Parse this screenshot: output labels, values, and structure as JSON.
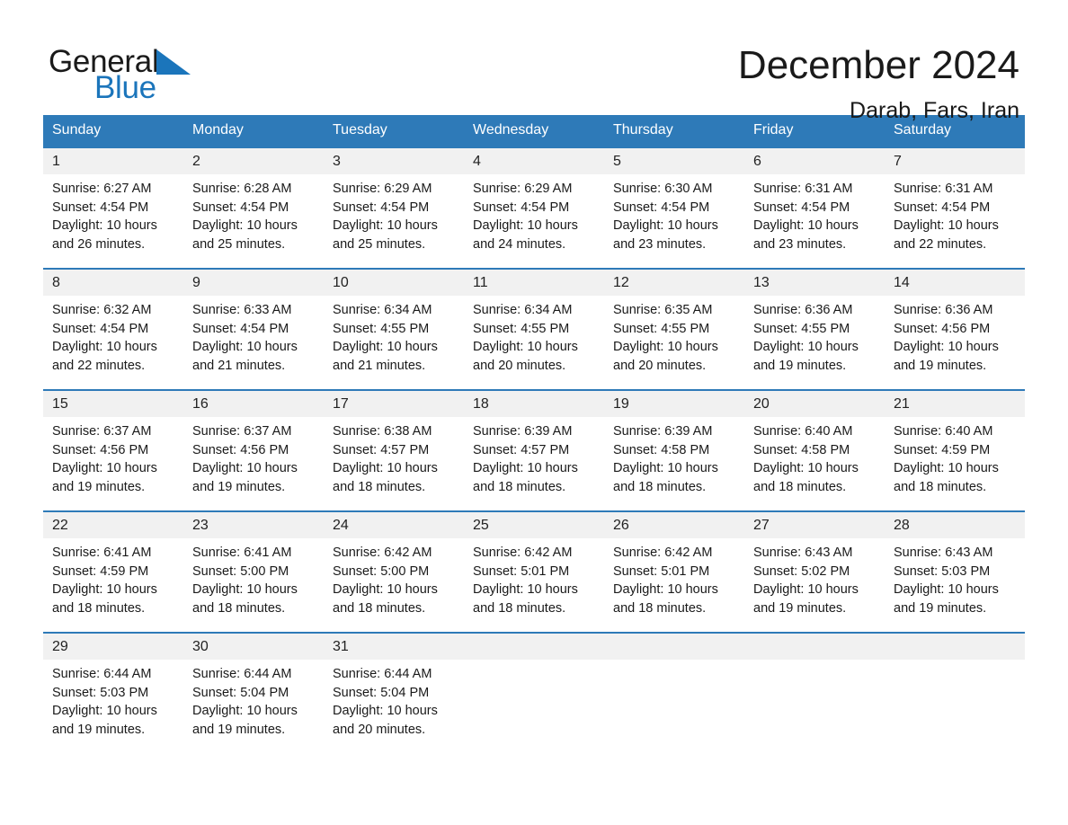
{
  "brand": {
    "name_part1": "General",
    "name_part2": "Blue",
    "accent_color": "#1b75bb"
  },
  "header": {
    "month_title": "December 2024",
    "location": "Darab, Fars, Iran"
  },
  "calendar": {
    "header_color": "#2e7ab8",
    "weekdays": [
      "Sunday",
      "Monday",
      "Tuesday",
      "Wednesday",
      "Thursday",
      "Friday",
      "Saturday"
    ],
    "labels": {
      "sunrise": "Sunrise:",
      "sunset": "Sunset:",
      "daylight": "Daylight:"
    },
    "weeks": [
      [
        {
          "day": "1",
          "sunrise": "Sunrise: 6:27 AM",
          "sunset": "Sunset: 4:54 PM",
          "daylight": "Daylight: 10 hours and 26 minutes."
        },
        {
          "day": "2",
          "sunrise": "Sunrise: 6:28 AM",
          "sunset": "Sunset: 4:54 PM",
          "daylight": "Daylight: 10 hours and 25 minutes."
        },
        {
          "day": "3",
          "sunrise": "Sunrise: 6:29 AM",
          "sunset": "Sunset: 4:54 PM",
          "daylight": "Daylight: 10 hours and 25 minutes."
        },
        {
          "day": "4",
          "sunrise": "Sunrise: 6:29 AM",
          "sunset": "Sunset: 4:54 PM",
          "daylight": "Daylight: 10 hours and 24 minutes."
        },
        {
          "day": "5",
          "sunrise": "Sunrise: 6:30 AM",
          "sunset": "Sunset: 4:54 PM",
          "daylight": "Daylight: 10 hours and 23 minutes."
        },
        {
          "day": "6",
          "sunrise": "Sunrise: 6:31 AM",
          "sunset": "Sunset: 4:54 PM",
          "daylight": "Daylight: 10 hours and 23 minutes."
        },
        {
          "day": "7",
          "sunrise": "Sunrise: 6:31 AM",
          "sunset": "Sunset: 4:54 PM",
          "daylight": "Daylight: 10 hours and 22 minutes."
        }
      ],
      [
        {
          "day": "8",
          "sunrise": "Sunrise: 6:32 AM",
          "sunset": "Sunset: 4:54 PM",
          "daylight": "Daylight: 10 hours and 22 minutes."
        },
        {
          "day": "9",
          "sunrise": "Sunrise: 6:33 AM",
          "sunset": "Sunset: 4:54 PM",
          "daylight": "Daylight: 10 hours and 21 minutes."
        },
        {
          "day": "10",
          "sunrise": "Sunrise: 6:34 AM",
          "sunset": "Sunset: 4:55 PM",
          "daylight": "Daylight: 10 hours and 21 minutes."
        },
        {
          "day": "11",
          "sunrise": "Sunrise: 6:34 AM",
          "sunset": "Sunset: 4:55 PM",
          "daylight": "Daylight: 10 hours and 20 minutes."
        },
        {
          "day": "12",
          "sunrise": "Sunrise: 6:35 AM",
          "sunset": "Sunset: 4:55 PM",
          "daylight": "Daylight: 10 hours and 20 minutes."
        },
        {
          "day": "13",
          "sunrise": "Sunrise: 6:36 AM",
          "sunset": "Sunset: 4:55 PM",
          "daylight": "Daylight: 10 hours and 19 minutes."
        },
        {
          "day": "14",
          "sunrise": "Sunrise: 6:36 AM",
          "sunset": "Sunset: 4:56 PM",
          "daylight": "Daylight: 10 hours and 19 minutes."
        }
      ],
      [
        {
          "day": "15",
          "sunrise": "Sunrise: 6:37 AM",
          "sunset": "Sunset: 4:56 PM",
          "daylight": "Daylight: 10 hours and 19 minutes."
        },
        {
          "day": "16",
          "sunrise": "Sunrise: 6:37 AM",
          "sunset": "Sunset: 4:56 PM",
          "daylight": "Daylight: 10 hours and 19 minutes."
        },
        {
          "day": "17",
          "sunrise": "Sunrise: 6:38 AM",
          "sunset": "Sunset: 4:57 PM",
          "daylight": "Daylight: 10 hours and 18 minutes."
        },
        {
          "day": "18",
          "sunrise": "Sunrise: 6:39 AM",
          "sunset": "Sunset: 4:57 PM",
          "daylight": "Daylight: 10 hours and 18 minutes."
        },
        {
          "day": "19",
          "sunrise": "Sunrise: 6:39 AM",
          "sunset": "Sunset: 4:58 PM",
          "daylight": "Daylight: 10 hours and 18 minutes."
        },
        {
          "day": "20",
          "sunrise": "Sunrise: 6:40 AM",
          "sunset": "Sunset: 4:58 PM",
          "daylight": "Daylight: 10 hours and 18 minutes."
        },
        {
          "day": "21",
          "sunrise": "Sunrise: 6:40 AM",
          "sunset": "Sunset: 4:59 PM",
          "daylight": "Daylight: 10 hours and 18 minutes."
        }
      ],
      [
        {
          "day": "22",
          "sunrise": "Sunrise: 6:41 AM",
          "sunset": "Sunset: 4:59 PM",
          "daylight": "Daylight: 10 hours and 18 minutes."
        },
        {
          "day": "23",
          "sunrise": "Sunrise: 6:41 AM",
          "sunset": "Sunset: 5:00 PM",
          "daylight": "Daylight: 10 hours and 18 minutes."
        },
        {
          "day": "24",
          "sunrise": "Sunrise: 6:42 AM",
          "sunset": "Sunset: 5:00 PM",
          "daylight": "Daylight: 10 hours and 18 minutes."
        },
        {
          "day": "25",
          "sunrise": "Sunrise: 6:42 AM",
          "sunset": "Sunset: 5:01 PM",
          "daylight": "Daylight: 10 hours and 18 minutes."
        },
        {
          "day": "26",
          "sunrise": "Sunrise: 6:42 AM",
          "sunset": "Sunset: 5:01 PM",
          "daylight": "Daylight: 10 hours and 18 minutes."
        },
        {
          "day": "27",
          "sunrise": "Sunrise: 6:43 AM",
          "sunset": "Sunset: 5:02 PM",
          "daylight": "Daylight: 10 hours and 19 minutes."
        },
        {
          "day": "28",
          "sunrise": "Sunrise: 6:43 AM",
          "sunset": "Sunset: 5:03 PM",
          "daylight": "Daylight: 10 hours and 19 minutes."
        }
      ],
      [
        {
          "day": "29",
          "sunrise": "Sunrise: 6:44 AM",
          "sunset": "Sunset: 5:03 PM",
          "daylight": "Daylight: 10 hours and 19 minutes."
        },
        {
          "day": "30",
          "sunrise": "Sunrise: 6:44 AM",
          "sunset": "Sunset: 5:04 PM",
          "daylight": "Daylight: 10 hours and 19 minutes."
        },
        {
          "day": "31",
          "sunrise": "Sunrise: 6:44 AM",
          "sunset": "Sunset: 5:04 PM",
          "daylight": "Daylight: 10 hours and 20 minutes."
        },
        {
          "day": "",
          "sunrise": "",
          "sunset": "",
          "daylight": ""
        },
        {
          "day": "",
          "sunrise": "",
          "sunset": "",
          "daylight": ""
        },
        {
          "day": "",
          "sunrise": "",
          "sunset": "",
          "daylight": ""
        },
        {
          "day": "",
          "sunrise": "",
          "sunset": "",
          "daylight": ""
        }
      ]
    ]
  }
}
